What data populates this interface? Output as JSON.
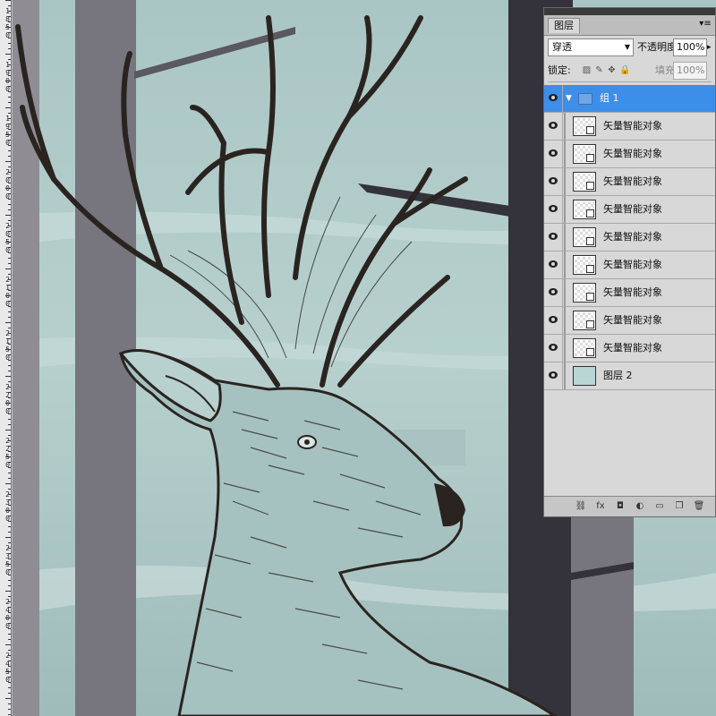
{
  "panel": {
    "tab_label": "图层",
    "menu_icon": "panel-menu-icon",
    "blend_mode": "穿透",
    "opacity_label": "不透明度:",
    "opacity_value": "100%",
    "lock_label": "锁定:",
    "fill_label": "填充:",
    "fill_value": "100%",
    "group": {
      "name": "组 1",
      "visible": true,
      "expanded": true
    },
    "layers": [
      {
        "name": "矢量智能对象",
        "type": "smart-object"
      },
      {
        "name": "矢量智能对象",
        "type": "smart-object"
      },
      {
        "name": "矢量智能对象",
        "type": "smart-object"
      },
      {
        "name": "矢量智能对象",
        "type": "smart-object"
      },
      {
        "name": "矢量智能对象",
        "type": "smart-object"
      },
      {
        "name": "矢量智能对象",
        "type": "smart-object"
      },
      {
        "name": "矢量智能对象",
        "type": "smart-object"
      },
      {
        "name": "矢量智能对象",
        "type": "smart-object"
      },
      {
        "name": "矢量智能对象",
        "type": "smart-object"
      },
      {
        "name": "图层 2",
        "type": "image"
      }
    ],
    "footer_icons": [
      "link-layers-icon",
      "fx-icon",
      "add-mask-icon",
      "adjustment-layer-icon",
      "new-group-icon",
      "new-layer-icon",
      "delete-icon"
    ],
    "footer_glyphs": [
      "⛓",
      "fx",
      "◘",
      "◐",
      "▭",
      "❐",
      "🗑"
    ]
  },
  "ruler": {
    "labels": [
      "1850",
      "1900",
      "1950",
      "2000",
      "2050",
      "2100",
      "2150",
      "2200",
      "2250",
      "2300",
      "2350",
      "2400",
      "2450"
    ]
  },
  "colors": {
    "selection": "#3d8ee8",
    "canvas_bg": "#9fb8b8",
    "tree_trunk": "#77757e",
    "ink": "#2a2420"
  }
}
